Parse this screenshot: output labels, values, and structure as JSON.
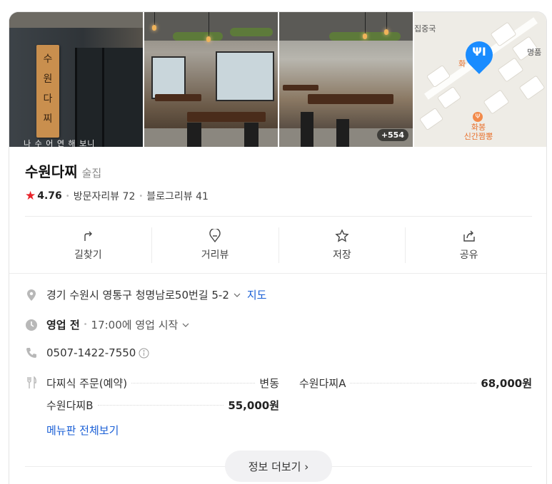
{
  "photos": {
    "count_badge": "+554",
    "sign_text": "수원다찌",
    "wall_text": "나 수 어 연 해 보니"
  },
  "map": {
    "labels": [
      "집중국",
      "명품",
      "화"
    ],
    "poi_label": "화봉\n신간짬뽕",
    "poi_icon": "utensils-icon",
    "pin_icon": "utensils-icon",
    "pin_color": "#1a8cff"
  },
  "place": {
    "name": "수원다찌",
    "category": "술집",
    "rating": "4.76",
    "visitor_reviews": "방문자리뷰 72",
    "blog_reviews": "블로그리뷰 41"
  },
  "actions": [
    {
      "label": "길찾기",
      "icon": "directions-icon"
    },
    {
      "label": "거리뷰",
      "icon": "streetview-icon"
    },
    {
      "label": "저장",
      "icon": "star-outline-icon"
    },
    {
      "label": "공유",
      "icon": "share-icon"
    }
  ],
  "info": {
    "address": "경기 수원시 영통구 청명남로50번길 5-2",
    "map_link": "지도",
    "status": "영업 전",
    "hours": "17:00에 영업 시작",
    "phone": "0507-1422-7550"
  },
  "menu": {
    "items": [
      {
        "name": "다찌식 주문(예약)",
        "price": "변동"
      },
      {
        "name": "수원다찌A",
        "price": "68,000원"
      },
      {
        "name": "수원다찌B",
        "price": "55,000원"
      }
    ],
    "more_link": "메뉴판 전체보기"
  },
  "more_button": "정보 더보기 ›",
  "colors": {
    "star": "#e8232a",
    "link": "#1a5fd6",
    "pin": "#1a8cff"
  }
}
